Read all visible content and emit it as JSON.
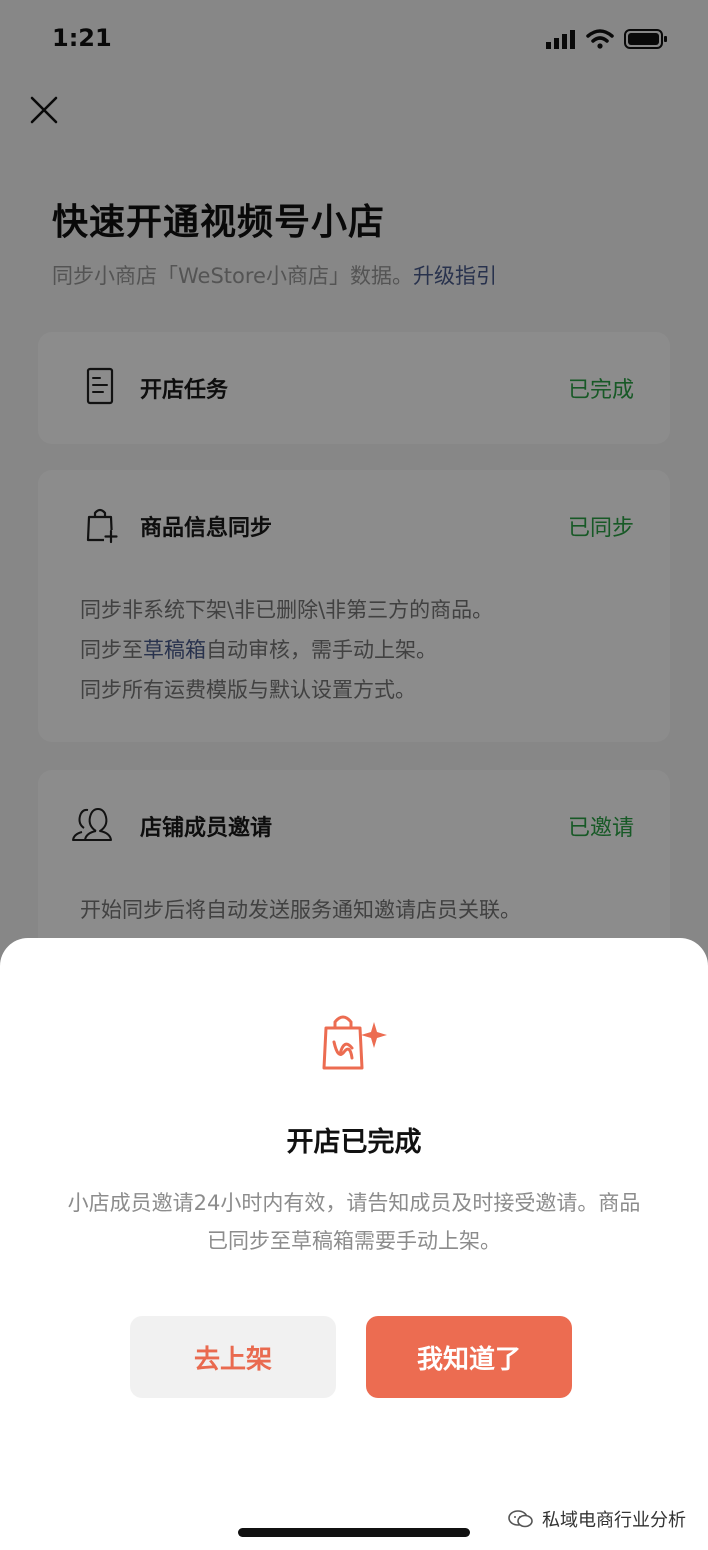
{
  "status_bar": {
    "time": "1:21"
  },
  "header": {
    "title": "快速开通视频号小店",
    "subtitle_text": "同步小商店「WeStore小商店」数据。",
    "subtitle_link": "升级指引"
  },
  "cards": [
    {
      "title": "开店任务",
      "status": "已完成",
      "icon": "document-icon"
    },
    {
      "title": "商品信息同步",
      "status": "已同步",
      "icon": "shopping-bag-add-icon",
      "lines": {
        "line1": "同步非系统下架\\非已删除\\非第三方的商品。",
        "line2_prefix": "同步至",
        "line2_link": "草稿箱",
        "line2_suffix": "自动审核，需手动上架。",
        "line3": "同步所有运费模版与默认设置方式。"
      }
    },
    {
      "title": "店铺成员邀请",
      "status": "已邀请",
      "icon": "members-icon",
      "lines": {
        "line1": "开始同步后将自动发送服务通知邀请店员关联。"
      }
    }
  ],
  "sheet": {
    "icon": "shop-bag-sparkle-icon",
    "title": "开店已完成",
    "description": "小店成员邀请24小时内有效，请告知成员及时接受邀请。商品已同步至草稿箱需要手动上架。",
    "secondary_button": "去上架",
    "primary_button": "我知道了"
  },
  "watermark": {
    "text": "私域电商行业分析"
  },
  "colors": {
    "accent": "#ec6c51",
    "status_green": "#2ba245",
    "link_blue": "#4a5b8c"
  }
}
